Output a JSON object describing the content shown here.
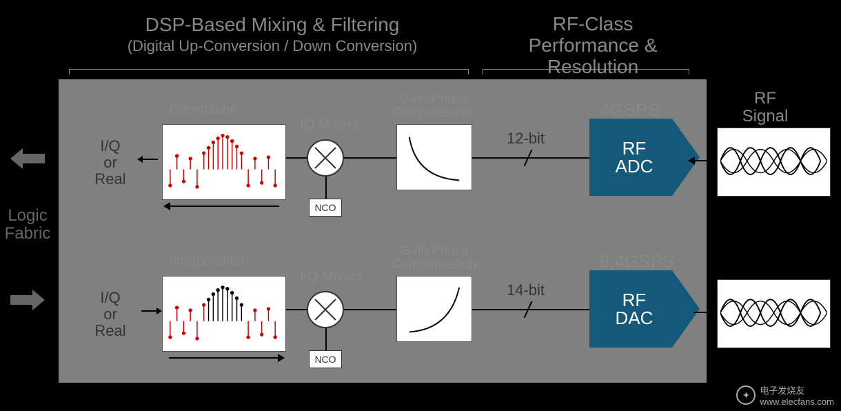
{
  "header": {
    "left_title": "DSP-Based Mixing & Filtering",
    "left_subtitle": "(Digital Up-Conversion / Down Conversion)",
    "right_title_l1": "RF-Class",
    "right_title_l2": "Performance &",
    "right_title_l3": "Resolution"
  },
  "left_side": {
    "logic_l1": "Logic",
    "logic_l2": "Fabric"
  },
  "right_side": {
    "rf_signal_l1": "RF",
    "rf_signal_l2": "Signal"
  },
  "lane_top": {
    "iq_l1": "I/Q",
    "iq_l2": "or",
    "iq_l3": "Real",
    "decim_label": "Decimation",
    "mixer_label": "IQ Mixers",
    "nco_label": "NCO",
    "comp_l1": "Gain/Phase",
    "comp_l2": "Compensation",
    "bit_label": "12-bit",
    "gsps": "4GSPS",
    "rf_l1": "RF",
    "rf_l2": "ADC"
  },
  "lane_bottom": {
    "iq_l1": "I/Q",
    "iq_l2": "or",
    "iq_l3": "Real",
    "decim_label": "Interpolation",
    "mixer_label": "I/Q Mixers",
    "nco_label": "NCO",
    "comp_l1": "Gain/Phase",
    "comp_l2": "Compensation",
    "bit_label": "14-bit",
    "gsps": "6.4GSPS",
    "rf_l1": "RF",
    "rf_l2": "DAC"
  },
  "watermark": {
    "site_cn": "电子发烧友",
    "site_url": "www.elecfans.com"
  }
}
